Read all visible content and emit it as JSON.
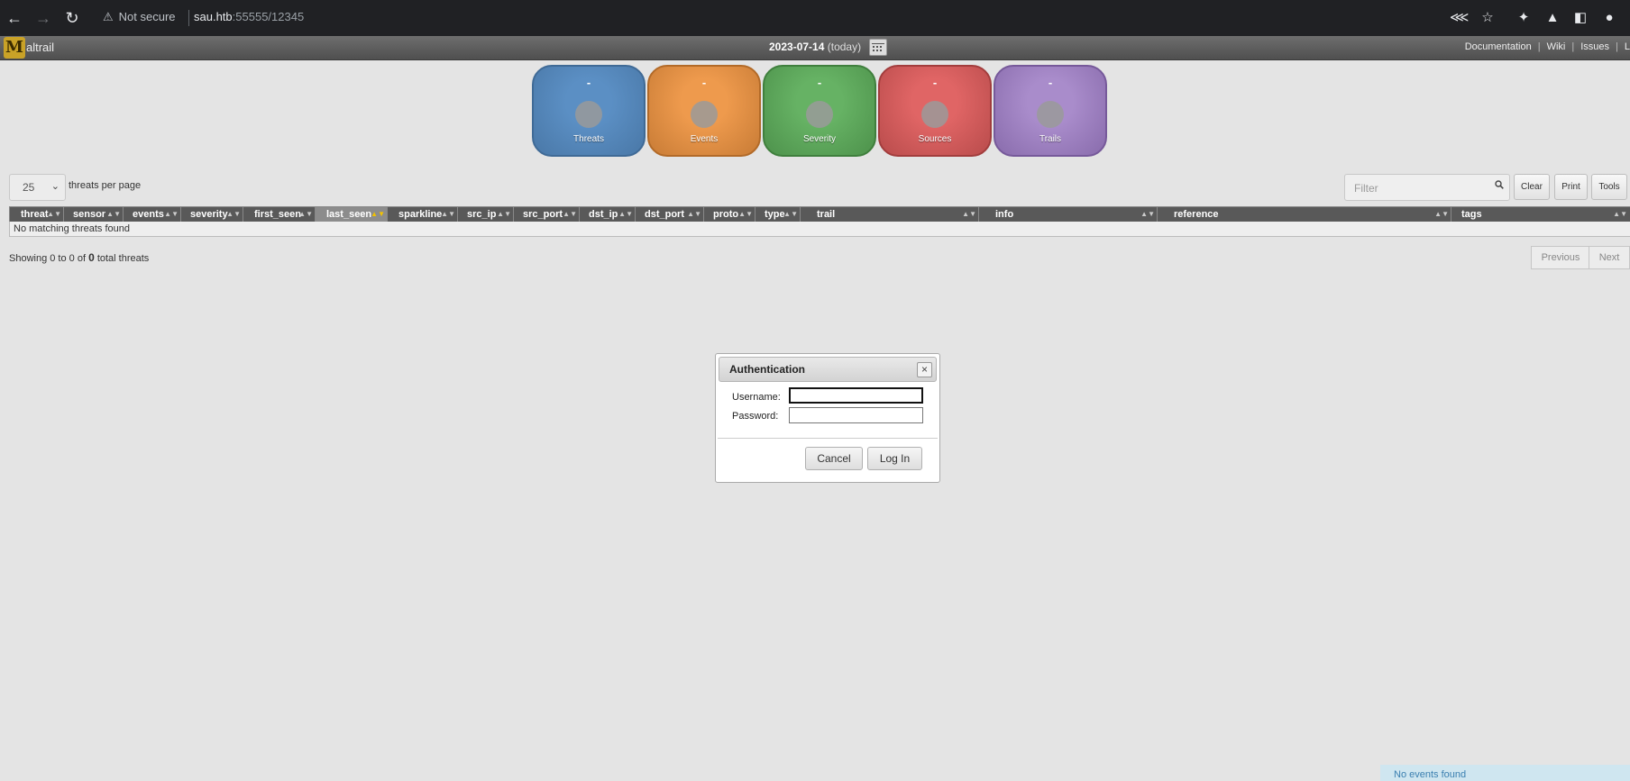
{
  "browser": {
    "security_label": "Not secure",
    "url_host": "sau.htb",
    "url_rest": ":55555/12345"
  },
  "header": {
    "app_name": "altrail",
    "date": "2023-07-14",
    "date_note": "(today)",
    "links": [
      "Documentation",
      "Wiki",
      "Issues",
      "L"
    ]
  },
  "stats": [
    {
      "label": "Threats",
      "value": "-",
      "color": "#5b8fc4",
      "border": "#3f6a96"
    },
    {
      "label": "Events",
      "value": "-",
      "color": "#ee9a4d",
      "border": "#b26a28"
    },
    {
      "label": "Severity",
      "value": "-",
      "color": "#66b264",
      "border": "#3f7f3d"
    },
    {
      "label": "Sources",
      "value": "-",
      "color": "#e06565",
      "border": "#a23d3d"
    },
    {
      "label": "Trails",
      "value": "-",
      "color": "#a98ccb",
      "border": "#76599a"
    }
  ],
  "controls": {
    "per_page_value": "25",
    "per_page_label": "threats per page",
    "filter_placeholder": "Filter",
    "clear_label": "Clear",
    "print_label": "Print",
    "tools_label": "Tools"
  },
  "table": {
    "columns": [
      "threat",
      "sensor",
      "events",
      "severity",
      "first_seen",
      "last_seen",
      "sparkline",
      "src_ip",
      "src_port",
      "dst_ip",
      "dst_port",
      "proto",
      "type",
      "trail",
      "info",
      "reference",
      "tags"
    ],
    "sorted_column": "last_seen",
    "empty_message": "No matching threats found"
  },
  "footer": {
    "showing_prefix": "Showing 0 to 0 of",
    "total": "0",
    "showing_suffix": "total threats",
    "previous_label": "Previous",
    "next_label": "Next"
  },
  "dialog": {
    "title": "Authentication",
    "close_symbol": "×",
    "username_label": "Username:",
    "password_label": "Password:",
    "cancel_label": "Cancel",
    "login_label": "Log In"
  },
  "notice": "No events found"
}
